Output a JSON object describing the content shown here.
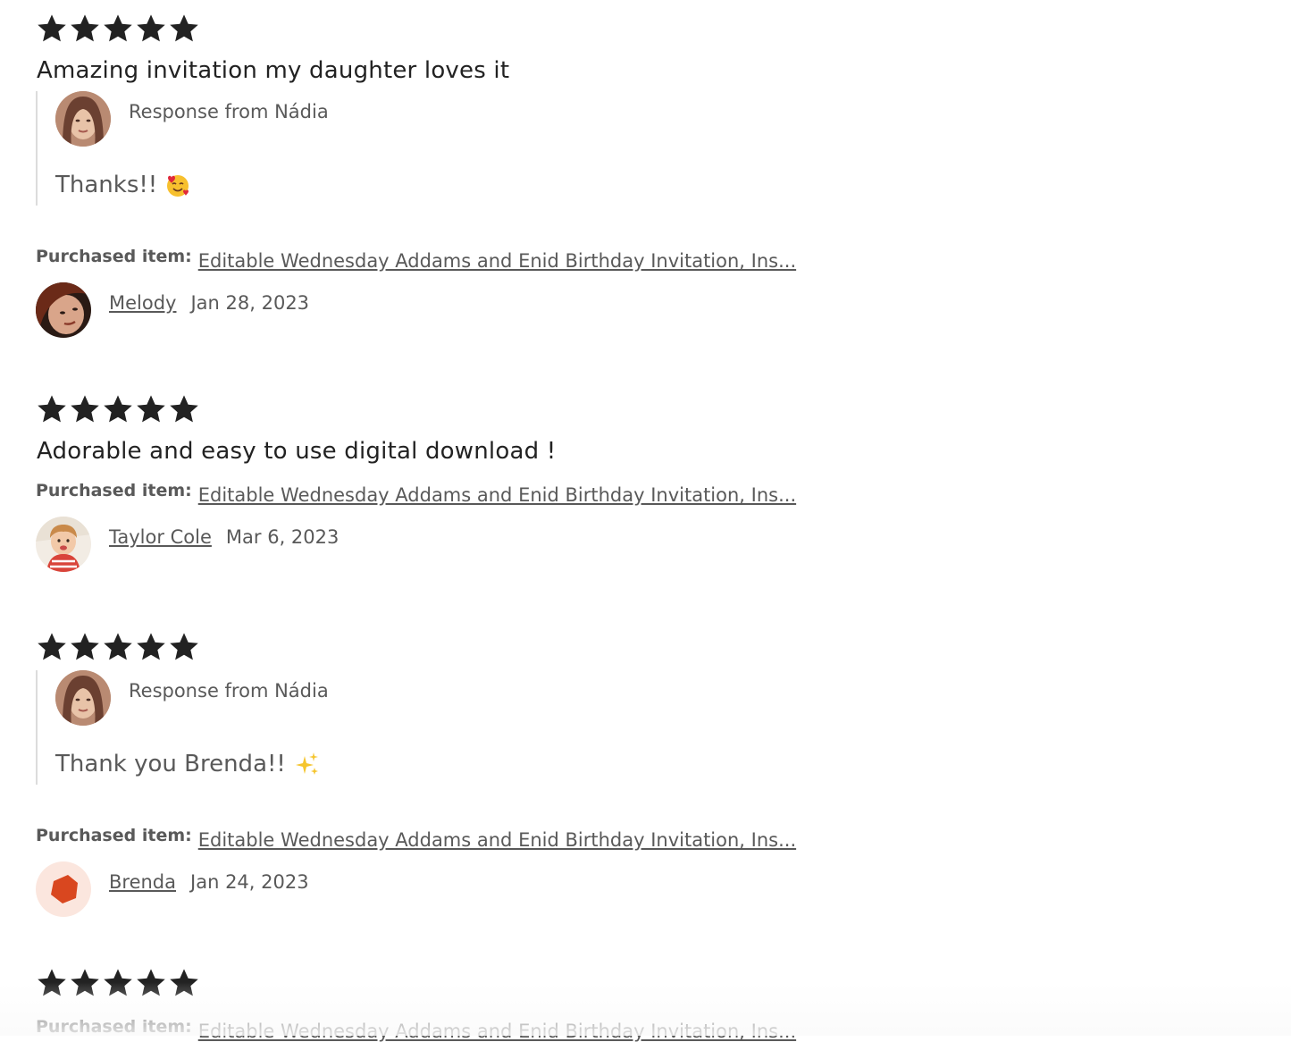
{
  "reviews": [
    {
      "rating": 5,
      "text": "Amazing invitation my daughter loves it",
      "response": {
        "label": "Response from Nádia",
        "text": "Thanks!!",
        "emoji": "smiling-face-with-hearts"
      },
      "purchased_label": "Purchased item:",
      "purchased_item": "Editable Wednesday Addams and Enid Birthday Invitation, Ins...",
      "reviewer": "Melody",
      "date": "Jan 28, 2023"
    },
    {
      "rating": 5,
      "text": "Adorable and easy to use digital download !",
      "purchased_label": "Purchased item:",
      "purchased_item": "Editable Wednesday Addams and Enid Birthday Invitation, Ins...",
      "reviewer": "Taylor Cole",
      "date": "Mar 6, 2023"
    },
    {
      "rating": 5,
      "response": {
        "label": "Response from Nádia",
        "text": "Thank you Brenda!!",
        "emoji": "sparkles"
      },
      "purchased_label": "Purchased item:",
      "purchased_item": "Editable Wednesday Addams and Enid Birthday Invitation, Ins...",
      "reviewer": "Brenda",
      "date": "Jan 24, 2023"
    },
    {
      "rating": 5,
      "purchased_label": "Purchased item:",
      "purchased_item": "Editable Wednesday Addams and Enid Birthday Invitation, Ins..."
    }
  ],
  "colors": {
    "star": "#222222",
    "text": "#222222",
    "muted": "#595959",
    "response_border": "#dcdcdc",
    "brenda_avatar_bg": "#fbe6de",
    "brenda_avatar_shape": "#d9471f"
  }
}
